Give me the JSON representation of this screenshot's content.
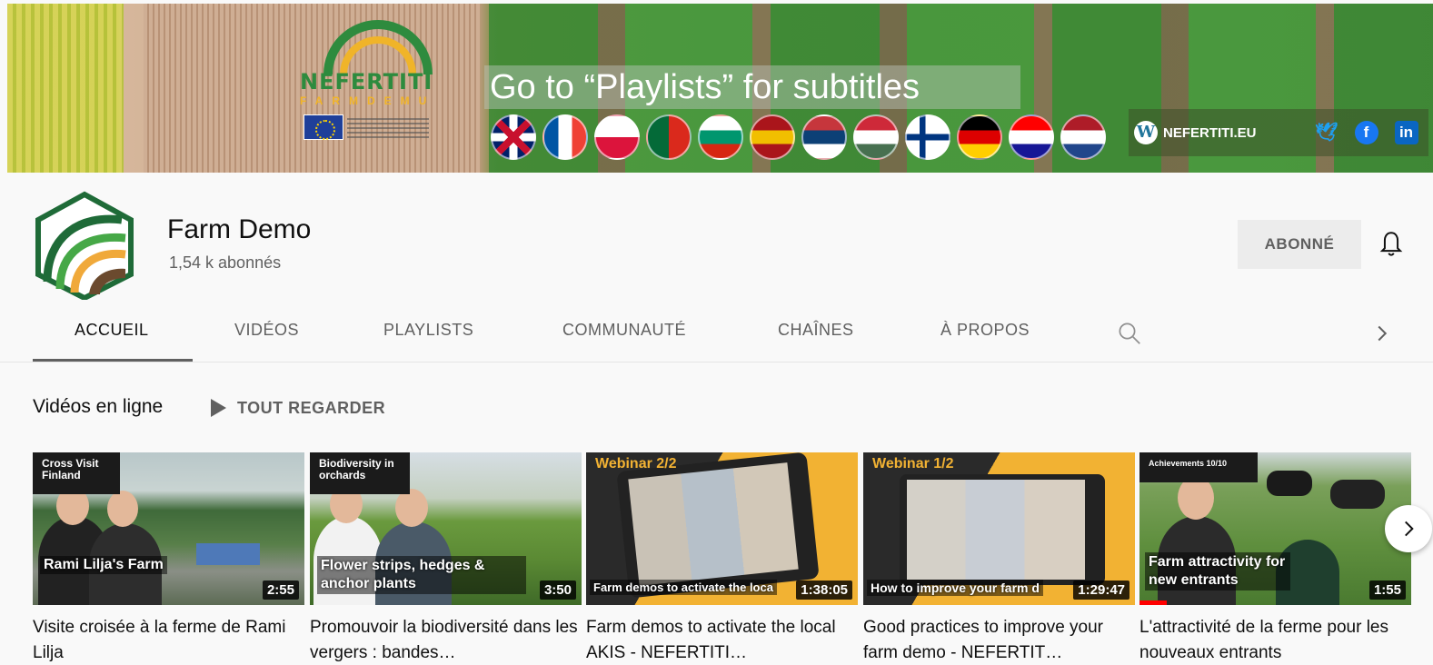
{
  "banner": {
    "logo_text": "NEFERTITI",
    "logo_sub": "FARMDEMU",
    "headline": "Go to “Playlists” for subtitles",
    "site_link": "NEFERTITI.EU",
    "flags": [
      {
        "country": "uk",
        "colors": [
          "#012169",
          "#c8102e",
          "#ffffff"
        ]
      },
      {
        "country": "france",
        "colors": [
          "#0055a4",
          "#ffffff",
          "#ef4135"
        ]
      },
      {
        "country": "poland",
        "colors": [
          "#ffffff",
          "#dc143c"
        ]
      },
      {
        "country": "portugal",
        "colors": [
          "#046a38",
          "#da291c"
        ]
      },
      {
        "country": "bulgaria",
        "colors": [
          "#ffffff",
          "#00966e",
          "#d62612"
        ]
      },
      {
        "country": "spain",
        "colors": [
          "#aa151b",
          "#f1bf00",
          "#aa151b"
        ]
      },
      {
        "country": "serbia",
        "colors": [
          "#c6363c",
          "#0c4076",
          "#ffffff"
        ]
      },
      {
        "country": "hungary",
        "colors": [
          "#ce2939",
          "#ffffff",
          "#477050"
        ]
      },
      {
        "country": "finland",
        "colors": [
          "#ffffff",
          "#003580"
        ]
      },
      {
        "country": "germany",
        "colors": [
          "#000000",
          "#dd0000",
          "#ffce00"
        ]
      },
      {
        "country": "croatia",
        "colors": [
          "#ff0000",
          "#ffffff",
          "#171796"
        ]
      },
      {
        "country": "netherlands",
        "colors": [
          "#ae1c28",
          "#ffffff",
          "#21468b"
        ]
      }
    ],
    "icons": [
      "wordpress-icon",
      "twitter-icon",
      "facebook-icon",
      "linkedin-icon"
    ]
  },
  "channel": {
    "name": "Farm Demo",
    "subscribers": "1,54 k abonnés",
    "subscribe_label": "ABONNÉ"
  },
  "tabs": [
    {
      "label": "ACCUEIL",
      "active": true
    },
    {
      "label": "VIDÉOS",
      "active": false
    },
    {
      "label": "PLAYLISTS",
      "active": false
    },
    {
      "label": "COMMUNAUTÉ",
      "active": false
    },
    {
      "label": "CHAÎNES",
      "active": false
    },
    {
      "label": "À PROPOS",
      "active": false
    }
  ],
  "shelf": {
    "title": "Vidéos en ligne",
    "play_all": "TOUT REGARDER",
    "videos": [
      {
        "tag": "Cross Visit Finland",
        "tag_bg": "#1b1b1b",
        "overlay": "Rami Lilja's Farm",
        "duration": "2:55",
        "title": "Visite croisée à la ferme de Rami Lilja"
      },
      {
        "tag": "Biodiversity in orchards",
        "tag_bg": "#1b1b1b",
        "overlay": "Flower strips, hedges & anchor plants",
        "duration": "3:50",
        "title": "Promouvoir la biodiversité dans les vergers : bandes…"
      },
      {
        "tag": "Webinar 2/2",
        "tag_bg": "#2a2a2a",
        "overlay": "Farm demos to activate the loca",
        "duration": "1:38:05",
        "title": "Farm demos to activate the local AKIS - NEFERTITI…"
      },
      {
        "tag": "Webinar 1/2",
        "tag_bg": "#2a2a2a",
        "overlay": "How to improve your farm d",
        "duration": "1:29:47",
        "title": "Good practices to improve your farm demo - NEFERTIT…"
      },
      {
        "tag": "Achievements 10/10",
        "tag_bg": "#1b1b1b",
        "overlay": "Farm attractivity for new entrants",
        "duration": "1:55",
        "title": "L'attractivité de la ferme pour les nouveaux entrants",
        "progress": 0.1
      }
    ]
  }
}
